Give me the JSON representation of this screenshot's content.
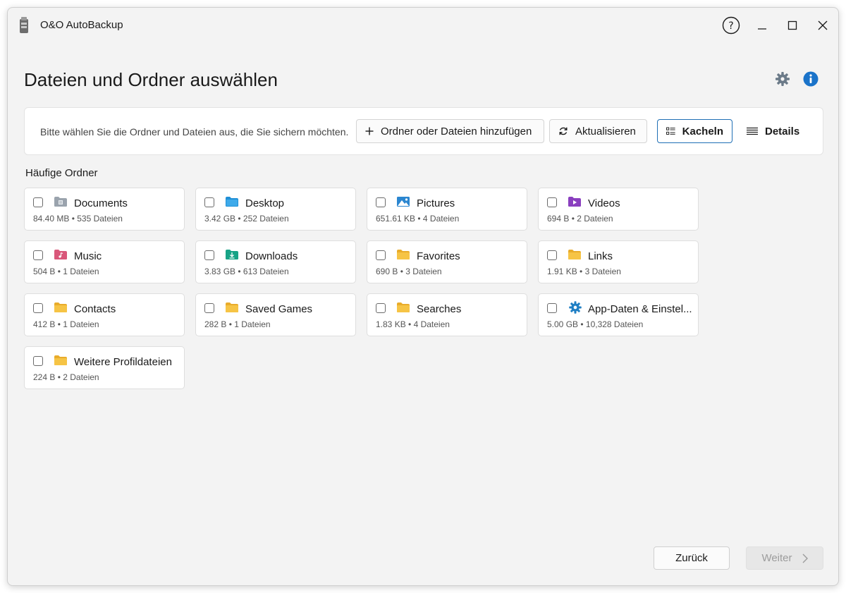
{
  "app": {
    "title": "O&O AutoBackup"
  },
  "page": {
    "title": "Dateien und Ordner auswählen"
  },
  "toolbar": {
    "hint": "Bitte wählen Sie die Ordner und Dateien aus, die Sie sichern möchten.",
    "add_label": "Ordner oder Dateien hinzufügen",
    "refresh_label": "Aktualisieren",
    "tiles_label": "Kacheln",
    "details_label": "Details"
  },
  "section": {
    "title": "Häufige Ordner"
  },
  "folders": [
    {
      "name": "Documents",
      "info": "84.40 MB • 535 Dateien",
      "icon": "documents-folder-icon",
      "checked": false
    },
    {
      "name": "Desktop",
      "info": "3.42 GB • 252 Dateien",
      "icon": "desktop-folder-icon",
      "checked": false
    },
    {
      "name": "Pictures",
      "info": "651.61 KB • 4 Dateien",
      "icon": "pictures-folder-icon",
      "checked": false
    },
    {
      "name": "Videos",
      "info": "694 B • 2 Dateien",
      "icon": "videos-folder-icon",
      "checked": false
    },
    {
      "name": "Music",
      "info": "504 B • 1 Dateien",
      "icon": "music-folder-icon",
      "checked": false
    },
    {
      "name": "Downloads",
      "info": "3.83 GB • 613 Dateien",
      "icon": "downloads-folder-icon",
      "checked": false
    },
    {
      "name": "Favorites",
      "info": "690 B • 3 Dateien",
      "icon": "folder-icon",
      "checked": false
    },
    {
      "name": "Links",
      "info": "1.91 KB • 3 Dateien",
      "icon": "folder-icon",
      "checked": false
    },
    {
      "name": "Contacts",
      "info": "412 B • 1 Dateien",
      "icon": "folder-icon",
      "checked": false
    },
    {
      "name": "Saved Games",
      "info": "282 B • 1 Dateien",
      "icon": "folder-icon",
      "checked": false
    },
    {
      "name": "Searches",
      "info": "1.83 KB • 4 Dateien",
      "icon": "folder-icon",
      "checked": false
    },
    {
      "name": "App-Daten & Einstel...",
      "info": "5.00 GB • 10,328 Dateien",
      "icon": "gear-icon",
      "checked": false
    },
    {
      "name": "Weitere Profildateien",
      "info": "224 B • 2 Dateien",
      "icon": "folder-icon",
      "checked": false
    }
  ],
  "footer": {
    "back_label": "Zurück",
    "next_label": "Weiter"
  },
  "colors": {
    "accent": "#1f6fb5",
    "folder_yellow": "#f6c445",
    "info_blue": "#1a73c9"
  }
}
